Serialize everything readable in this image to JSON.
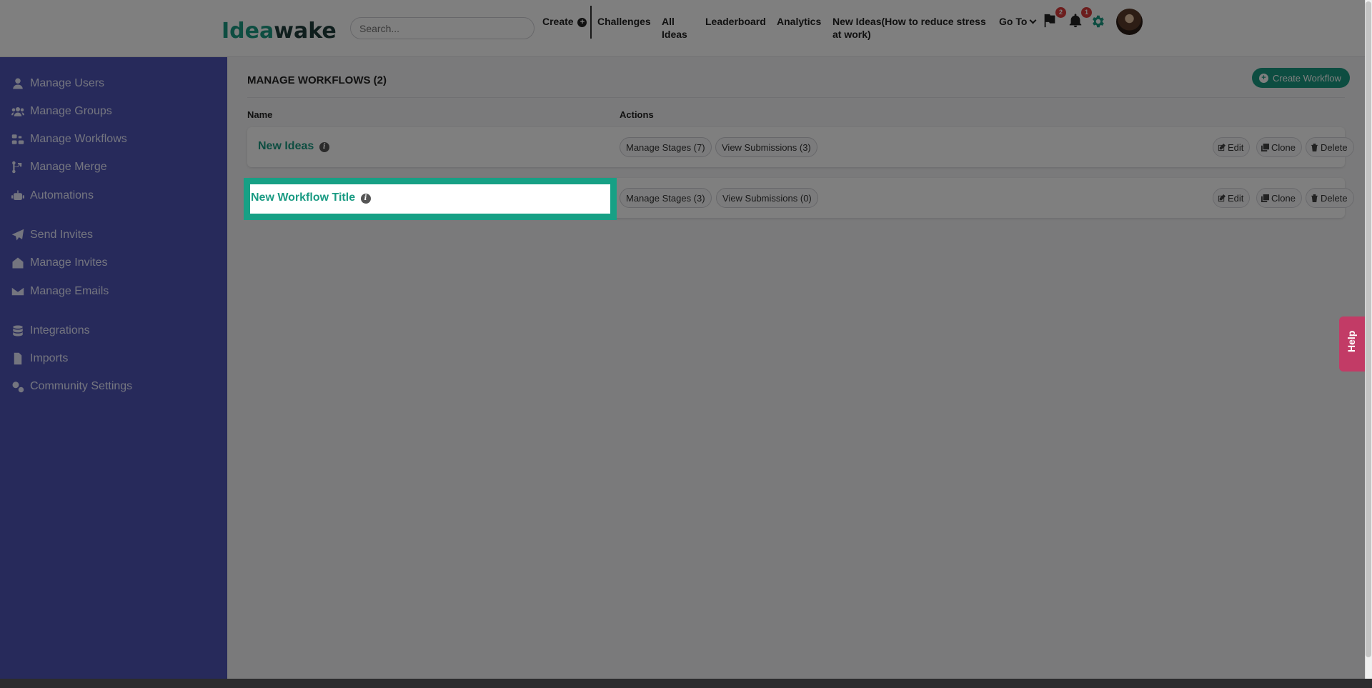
{
  "header": {
    "logo_a": "Idea",
    "logo_b": "wake",
    "search_placeholder": "Search...",
    "nav": {
      "create": "Create",
      "challenges": "Challenges",
      "all_ideas": "All Ideas",
      "leaderboard": "Leaderboard",
      "analytics": "Analytics",
      "new_ideas": "New Ideas(How to reduce stress at work)",
      "go_to": "Go To"
    },
    "flag_badge": "2",
    "bell_badge": "1"
  },
  "sidebar": {
    "items": [
      {
        "label": "Manage Users",
        "icon": "user-icon"
      },
      {
        "label": "Manage Groups",
        "icon": "users-icon"
      },
      {
        "label": "Manage Workflows",
        "icon": "workflow-icon"
      },
      {
        "label": "Manage Merge",
        "icon": "merge-icon"
      },
      {
        "label": "Automations",
        "icon": "robot-icon"
      },
      {
        "label": "Send Invites",
        "icon": "paper-plane-icon"
      },
      {
        "label": "Manage Invites",
        "icon": "invites-icon"
      },
      {
        "label": "Manage Emails",
        "icon": "envelope-icon"
      },
      {
        "label": "Integrations",
        "icon": "database-icon"
      },
      {
        "label": "Imports",
        "icon": "file-import-icon"
      },
      {
        "label": "Community Settings",
        "icon": "cogs-icon"
      }
    ]
  },
  "main": {
    "title": "MANAGE WORKFLOWS (2)",
    "create_button": "Create Workflow",
    "columns": {
      "name": "Name",
      "actions": "Actions"
    },
    "rows": [
      {
        "name": "New Ideas",
        "stages": "Manage Stages (7)",
        "submissions": "View Submissions (3)",
        "edit": "Edit",
        "clone": "Clone",
        "delete": "Delete"
      },
      {
        "name": "New Workflow Title",
        "stages": "Manage Stages (3)",
        "submissions": "View Submissions (0)",
        "edit": "Edit",
        "clone": "Clone",
        "delete": "Delete"
      }
    ]
  },
  "help_tab": "Help",
  "colors": {
    "accent": "#1a9b83",
    "sidebar": "#4f55b6",
    "help": "#c23b66",
    "badge": "#d93a3a"
  }
}
